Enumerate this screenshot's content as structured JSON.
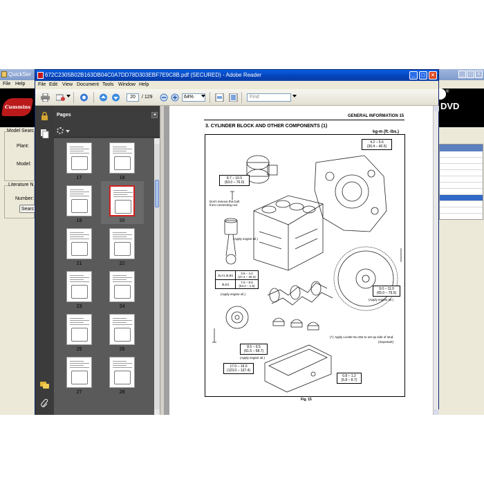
{
  "background_app": {
    "title": "QuickSer",
    "menu": [
      "File",
      "Help"
    ],
    "logo_text": "Cummins",
    "left_panel": {
      "model_search_label": "Model Searc",
      "plant_label": "Plant:",
      "model_label": "Model:",
      "literature_label": "Literature N",
      "number_label": "Number:",
      "search_button": "Searc"
    },
    "right_banner_text": "DVD",
    "registered_mark": "®"
  },
  "reader": {
    "title": "672C2305B02B163DB04C0A7DD78D303EBF7E9C8B.pdf (SECURED) - Adobe Reader",
    "window_buttons": {
      "minimize": "_",
      "maximize": "□",
      "close": "×"
    },
    "menu": [
      "File",
      "Edit",
      "View",
      "Document",
      "Tools",
      "Window",
      "Help"
    ],
    "toolbar": {
      "page_current": "20",
      "page_total": "/ 129",
      "zoom": "64%",
      "find_placeholder": "Find"
    },
    "pages_panel": {
      "title": "Pages",
      "collapse": "◂",
      "thumbnails": [
        {
          "label": "17"
        },
        {
          "label": "18"
        },
        {
          "label": "19"
        },
        {
          "label": "20",
          "selected": true
        },
        {
          "label": "21"
        },
        {
          "label": "22"
        },
        {
          "label": "23"
        },
        {
          "label": "24"
        },
        {
          "label": "25"
        },
        {
          "label": "26"
        },
        {
          "label": "27"
        },
        {
          "label": "28"
        }
      ]
    },
    "document": {
      "running_header": "GENERAL INFORMATION  15",
      "section_title": "3.  CYLINDER BLOCK AND OTHER COMPONENTS (1)",
      "units": "kg-m (ft.-lbs.)",
      "figure_caption": "Fig. 15",
      "callouts": {
        "top_right": [
          "4.2 – 5.6",
          "(30.4 – 40.5)"
        ],
        "top_left": [
          "8.7 – 10.5",
          "(63.0 – 76.0)"
        ],
        "flywheel": [
          "9.0 – 11.0",
          "(65.0 – 79.5)"
        ],
        "crank_pulley": [
          "8.5 – 9.5",
          "(61.5 – 68.7)"
        ],
        "bottom_left": [
          "17.0 – 19.0",
          "(123.0 – 137.4)"
        ],
        "oil_pan": [
          "0.8 – 1.2",
          "(5.8 – 8.7)"
        ]
      },
      "annotations": {
        "dont_remove": [
          "Don't remove this bolt",
          "from connecting rod."
        ],
        "apply_oil_1": "(Apply engine oil.)",
        "apply_oil_2": "(Apply engine oil.)",
        "apply_oil_3": "(Apply engine oil.)",
        "apply_oil_4": "(Apply engine oil.)",
        "loctite": "(*): Apply Loctite No.262 to set up side of stud.",
        "important": "(Important)"
      },
      "spec_table": [
        [
          "3LA1,3LB1",
          "3.6 – 4.2",
          "(27.4 – 30.3)"
        ],
        [
          "3LD1",
          "7.5 – 8.5",
          "(54.2 – 1.5)"
        ]
      ]
    }
  }
}
